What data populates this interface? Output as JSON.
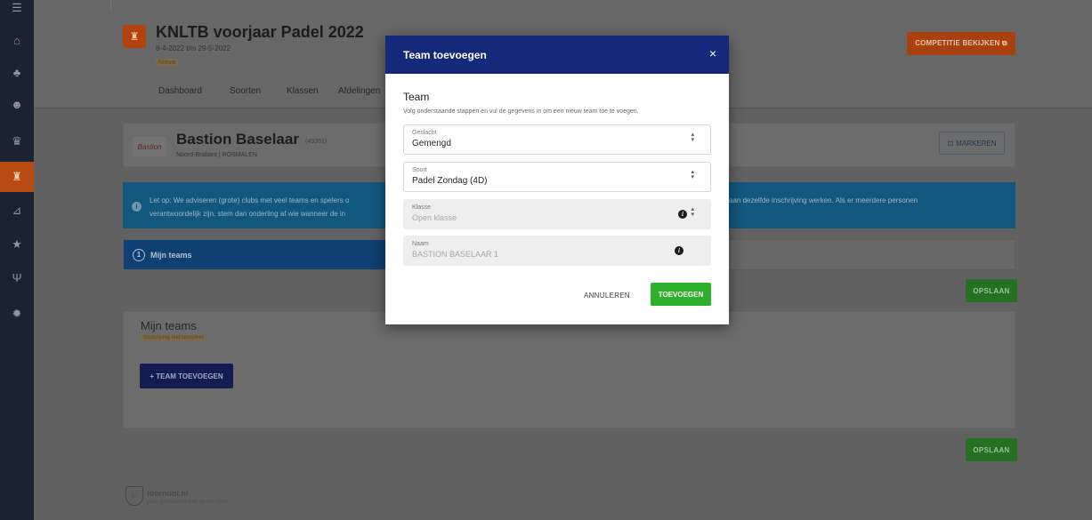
{
  "sidebar": {
    "icons": [
      "menu-icon",
      "home-icon",
      "org-chart-icon",
      "users-icon",
      "medal-icon",
      "trophy-icon",
      "chart-icon",
      "star-icon",
      "utensils-icon",
      "gear-icon"
    ],
    "glyphs": [
      "☰",
      "⌂",
      "♣",
      "☻",
      "♛",
      "♜",
      "⊿",
      "★",
      "Ψ",
      "✹"
    ]
  },
  "header": {
    "competition_title": "KNLTB voorjaar Padel 2022",
    "dates": "8-4-2022 t/m 29-5-2022",
    "badge": "Nieuw",
    "tabs": [
      "Dashboard",
      "Soorten",
      "Klassen",
      "Afdelingen"
    ],
    "view_competition_label": "COMPETITIE BEKIJKEN ⧉"
  },
  "club": {
    "logo_text": "Bastion",
    "name": "Bastion Baselaar",
    "id": "(49361)",
    "location": "Noord-Brabant | ROSMALEN",
    "mark_label": "MARKEREN"
  },
  "info": {
    "icon": "i",
    "text_line1": "Let op: We adviseren (grote) clubs met veel teams en spelers o",
    "text_line2": "verantwoordelijk zijn, stem dan onderling af wie wanneer de in",
    "text_line1_right": "aan dezelfde inschrijving werken. Als er meerdere personen"
  },
  "steps": {
    "number": "1",
    "label": "Mijn teams"
  },
  "save_label": "OPSLAAN",
  "teams": {
    "title": "Mijn teams",
    "badge": "Inschrijving niet compleet",
    "add_team_label": "+ TEAM TOEVOEGEN"
  },
  "footer": {
    "name": "toernooi.nl",
    "tagline": "jouw sportstatistieken op één plek!"
  },
  "modal": {
    "title": "Team toevoegen",
    "close": "×",
    "section_title": "Team",
    "subtitle": "Volg onderstaande stappen en vul de gegevens in om een nieuw team toe te voegen.",
    "fields": [
      {
        "label": "Geslacht",
        "value": "Gemengd"
      },
      {
        "label": "Soort",
        "value": "Padel Zondag (4D)"
      },
      {
        "label": "Klasse",
        "value": "Open klasse"
      },
      {
        "label": "Naam",
        "value": "BASTION BASELAAR 1"
      }
    ],
    "cancel_label": "ANNULEREN",
    "add_label": "TOEVOEGEN"
  }
}
